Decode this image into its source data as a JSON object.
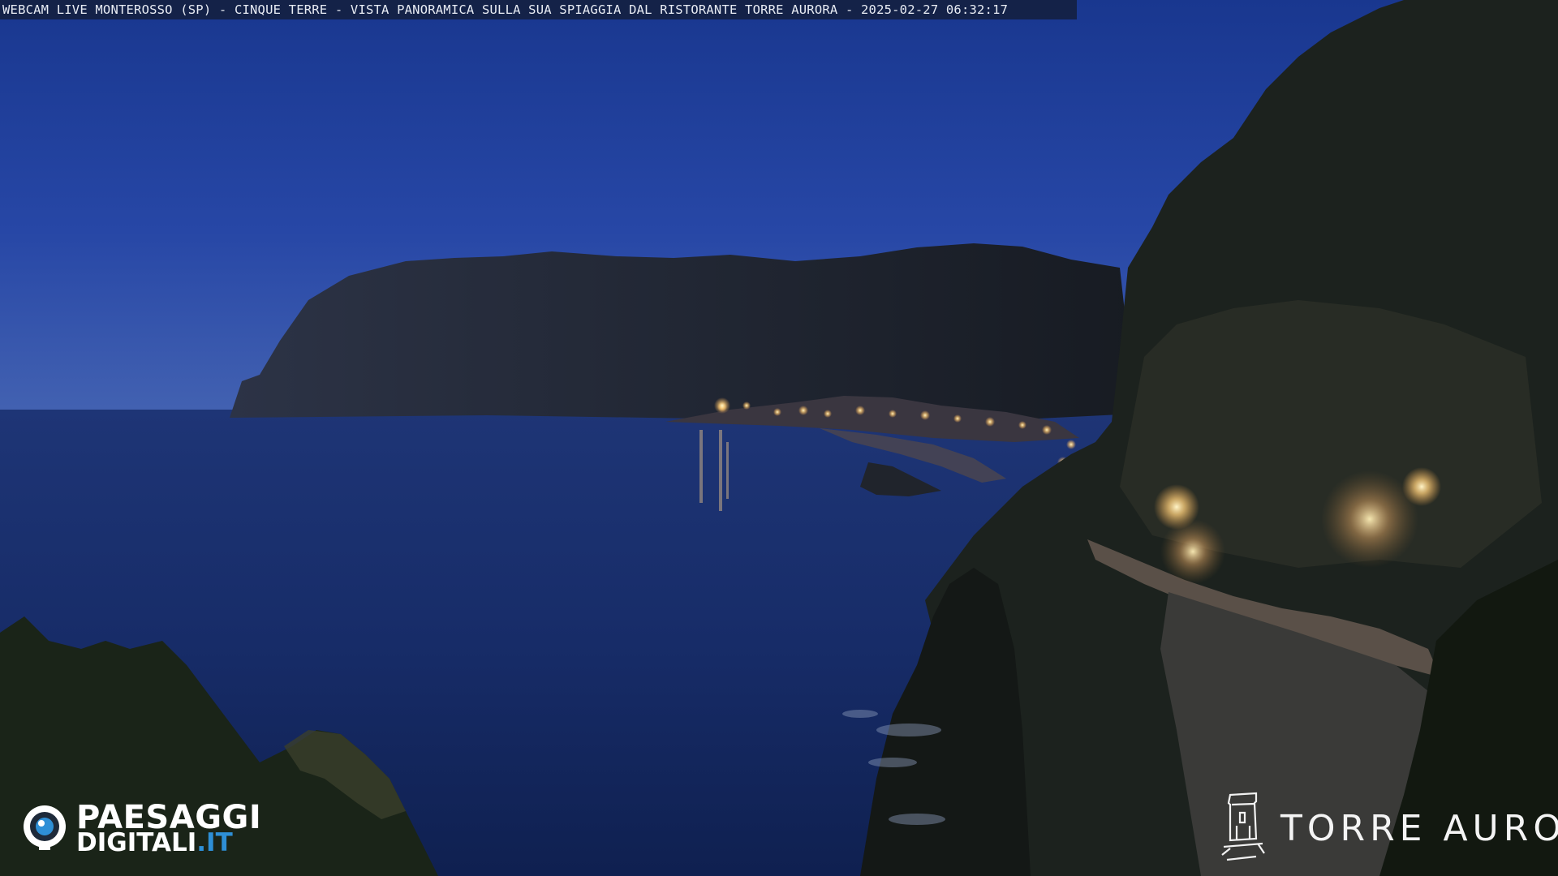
{
  "overlay": {
    "caption": "WEBCAM LIVE MONTEROSSO (SP) - CINQUE TERRE - VISTA PANORAMICA SULLA SUA SPIAGGIA DAL RISTORANTE TORRE AURORA - 2025-02-27 06:32:17"
  },
  "logo_left": {
    "line1": "PAESAGGI",
    "line2_main": "DIGITALI",
    "line2_accent": ".IT",
    "accent_color": "#2e8fd6",
    "icon": "eye-icon"
  },
  "logo_right": {
    "text": "TORRE AURORA",
    "icon": "tower-icon"
  },
  "colors": {
    "sky_top": "#1c3a9c",
    "sky_horizon": "#3a58b0",
    "sea": "#142a6a",
    "land": "#1a2030",
    "lights": "#ffd890"
  }
}
